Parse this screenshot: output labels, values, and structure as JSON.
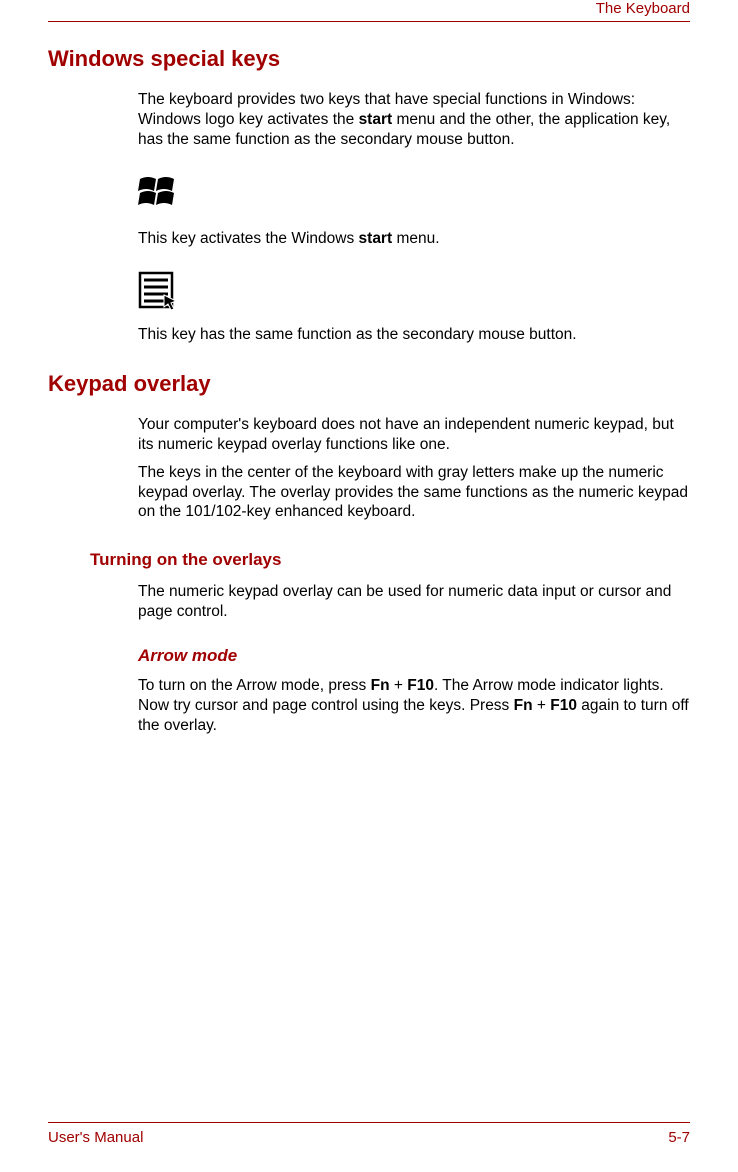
{
  "header": {
    "section_title": "The Keyboard"
  },
  "sections": {
    "windows_keys": {
      "heading": "Windows special keys",
      "intro_pre": "The keyboard provides two keys that have special functions in Windows: Windows logo key activates the ",
      "intro_bold": "start",
      "intro_post": " menu and the other, the application key, has the same function as the secondary mouse button.",
      "win_key_desc_pre": "This key activates the Windows ",
      "win_key_desc_bold": "start",
      "win_key_desc_post": " menu.",
      "app_key_desc": "This key has the same function as the secondary mouse button."
    },
    "keypad_overlay": {
      "heading": "Keypad overlay",
      "p1": "Your computer's keyboard does not have an independent numeric keypad, but its numeric keypad overlay functions like one.",
      "p2": "The keys in the center of the keyboard with gray letters make up the numeric keypad overlay. The overlay provides the same functions as the numeric keypad on the 101/102-key enhanced keyboard.",
      "subheading": "Turning on the overlays",
      "sub_p1": "The numeric keypad overlay can be used for numeric data input or cursor and page control.",
      "arrow_heading": "Arrow mode",
      "arrow_pre": "To turn on the Arrow mode, press ",
      "arrow_key1": "Fn",
      "arrow_plus1": " + ",
      "arrow_key2": "F10",
      "arrow_mid": ". The Arrow mode indicator lights. Now try cursor and page control using the keys. Press ",
      "arrow_key3": "Fn",
      "arrow_plus2": " + ",
      "arrow_key4": "F10",
      "arrow_post": " again to turn off the overlay."
    }
  },
  "footer": {
    "left": "User's Manual",
    "right": "5-7"
  },
  "icons": {
    "windows_logo": "windows-logo-icon",
    "application_key": "application-menu-icon"
  }
}
